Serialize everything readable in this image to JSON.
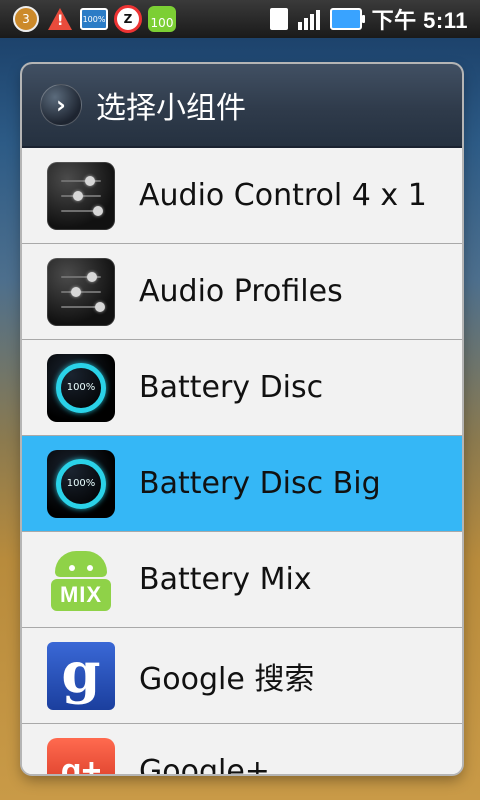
{
  "status_bar": {
    "badge_count": "3",
    "battery_small_text": "100%",
    "alarm_letter": "Z",
    "android_badge": "100",
    "time": "下午 5:11"
  },
  "dialog": {
    "title": "选择小组件",
    "items": [
      {
        "label": "Audio Control 4 x 1",
        "icon": "audio-control-icon",
        "selected": false
      },
      {
        "label": "Audio Profiles",
        "icon": "audio-profiles-icon",
        "selected": false
      },
      {
        "label": "Battery Disc",
        "icon": "battery-disc-icon",
        "selected": false
      },
      {
        "label": "Battery Disc Big",
        "icon": "battery-disc-big-icon",
        "selected": true
      },
      {
        "label": "Battery Mix",
        "icon": "battery-mix-icon",
        "selected": false
      },
      {
        "label": "Google 搜索",
        "icon": "google-search-icon",
        "selected": false
      },
      {
        "label": "Google+",
        "icon": "google-plus-icon",
        "selected": false
      }
    ],
    "icons_text": {
      "battery_pct": "100%",
      "mix": "MIX",
      "google_g": "g",
      "gplus": "g+"
    }
  },
  "colors": {
    "selected_row": "#35b7f6",
    "header_bg": "#2f3b4b",
    "list_bg": "#f2f2f2"
  }
}
